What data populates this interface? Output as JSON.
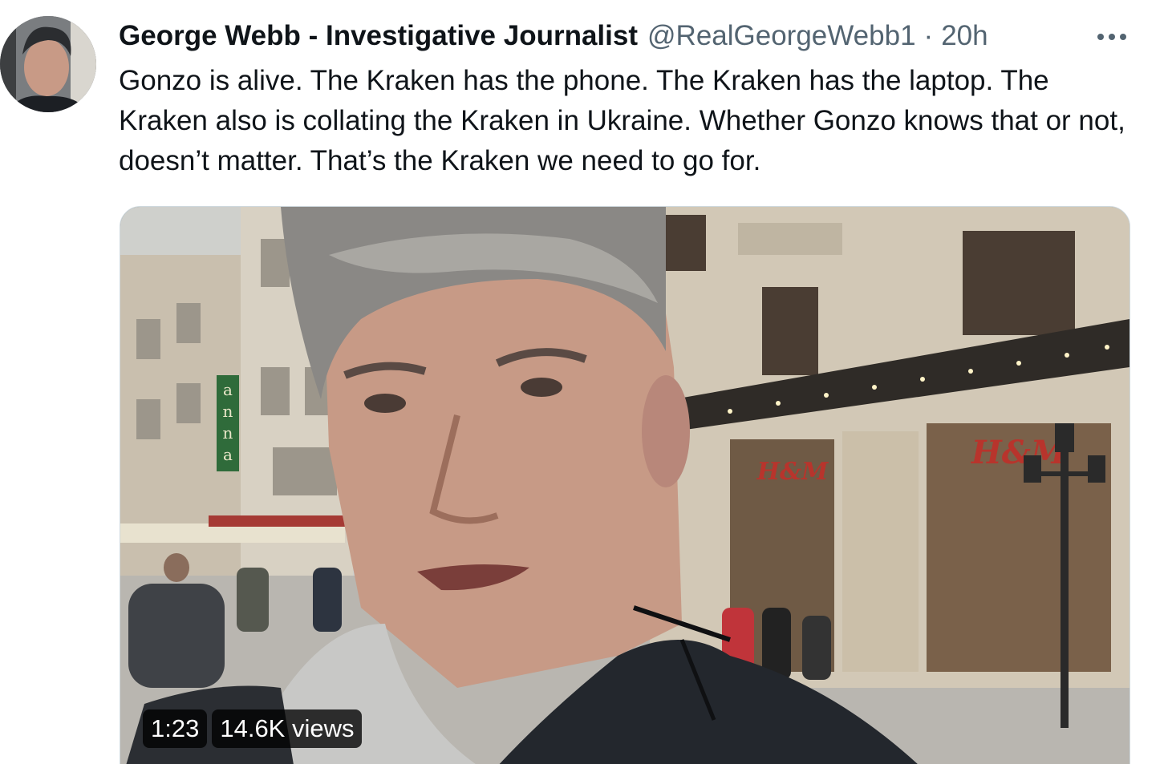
{
  "tweet": {
    "author": {
      "display_name": "George Webb - Investigative Journalist",
      "handle": "@RealGeorgeWebb1",
      "separator": "·",
      "time": "20h"
    },
    "text": "Gonzo is alive. The Kraken has the phone. The Kraken has the laptop. The Kraken also is collating the Kraken in Ukraine. Whether Gonzo knows that or not, doesn’t matter. That’s the Kraken we need to go for.",
    "more_icon": "more-horizontal-icon",
    "media": {
      "type": "video",
      "duration": "1:23",
      "views": "14.6K views",
      "storefront_signs": [
        "H&M",
        "H&M",
        "anna"
      ]
    }
  },
  "colors": {
    "primary_text": "#0f1419",
    "secondary_text": "#536471",
    "media_border": "#cfd9de",
    "badge_background": "#000000"
  }
}
